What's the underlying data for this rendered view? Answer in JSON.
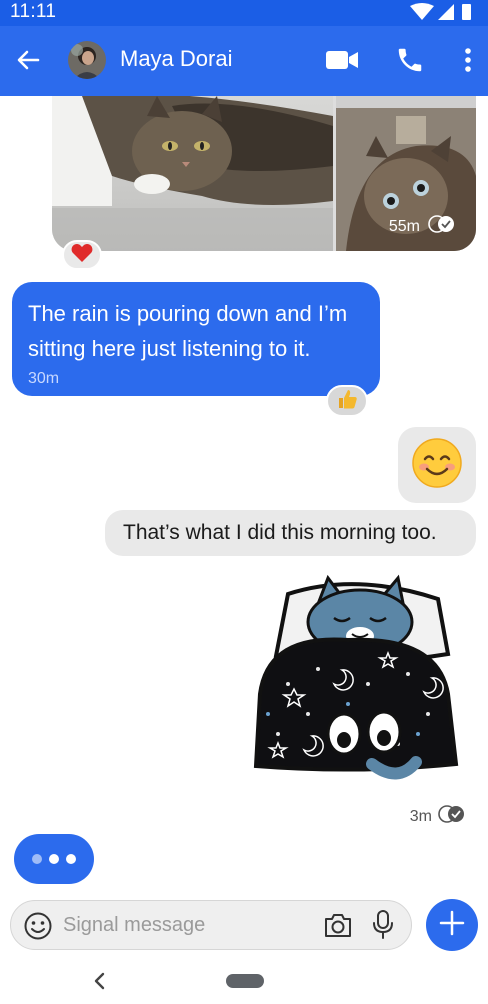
{
  "status": {
    "time": "11:11"
  },
  "header": {
    "contact_name": "Maya Dorai"
  },
  "messages": {
    "media": {
      "time": "55m",
      "reaction": "heart"
    },
    "incoming_text": {
      "text": "The rain is pouring down and I’m sitting here just listening to it.",
      "time": "30m",
      "reaction": "thumbs-up"
    },
    "outgoing_emoji": {
      "emoji": "😊"
    },
    "outgoing_text": {
      "text": "That’s what I did this morning too."
    },
    "sticker": {
      "time": "3m"
    }
  },
  "composer": {
    "placeholder": "Signal message"
  },
  "colors": {
    "primary": "#2c6bed",
    "statusbar": "#1b5ee6",
    "bubble_grey": "#e9e9e9"
  },
  "icons": [
    "back-arrow-icon",
    "video-call-icon",
    "phone-icon",
    "more-icon",
    "heart-icon",
    "thumbs-up-icon",
    "read-receipt-icon",
    "emoji-icon",
    "camera-icon",
    "mic-icon",
    "plus-icon",
    "nav-back-icon"
  ]
}
